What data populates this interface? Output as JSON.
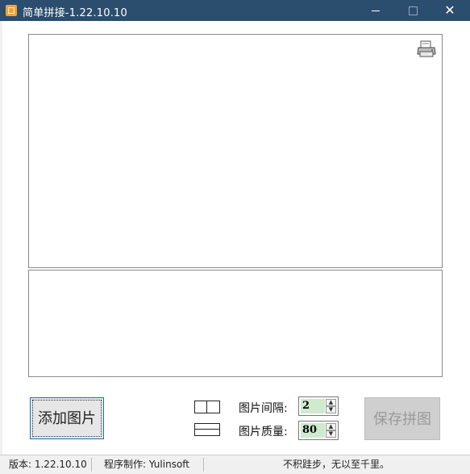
{
  "window": {
    "title": "简单拼接-1.22.10.10",
    "close_glyph": "✕"
  },
  "controls": {
    "add_button": "添加图片",
    "gap_label": "图片间隔:",
    "gap_value": "2",
    "quality_label": "图片质量:",
    "quality_value": "80",
    "save_button": "保存拼图",
    "spin_up": "▲",
    "spin_down": "▼"
  },
  "statusbar": {
    "version": "版本: 1.22.10.10",
    "author": "程序制作: Yulinsoft",
    "motto": "不积跬步，无以至千里。"
  },
  "icons": {
    "printer": "printer-icon",
    "layout_horizontal": "layout-horizontal-icon",
    "layout_vertical": "layout-vertical-icon"
  },
  "colors": {
    "titlebar": "#2b4e6e",
    "spin_value_bg": "#cfeacf",
    "add_button_border": "#1e6bb8"
  }
}
